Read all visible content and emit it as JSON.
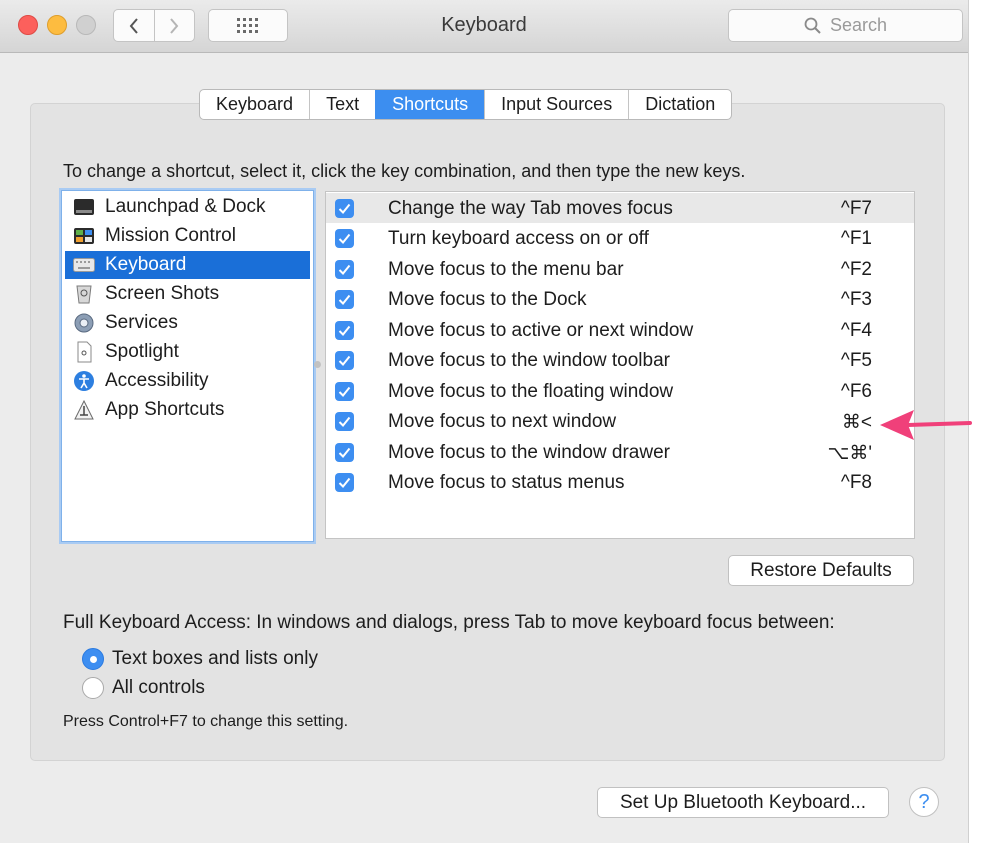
{
  "window": {
    "title": "Keyboard"
  },
  "search": {
    "placeholder": "Search"
  },
  "tabs": [
    {
      "label": "Keyboard",
      "active": false
    },
    {
      "label": "Text",
      "active": false
    },
    {
      "label": "Shortcuts",
      "active": true
    },
    {
      "label": "Input Sources",
      "active": false
    },
    {
      "label": "Dictation",
      "active": false
    }
  ],
  "instructions": "To change a shortcut, select it, click the key combination, and then type the new keys.",
  "categories": [
    {
      "label": "Launchpad & Dock",
      "icon": "launchpad-dock-icon",
      "selected": false
    },
    {
      "label": "Mission Control",
      "icon": "mission-control-icon",
      "selected": false
    },
    {
      "label": "Keyboard",
      "icon": "keyboard-icon",
      "selected": true
    },
    {
      "label": "Screen Shots",
      "icon": "screenshot-icon",
      "selected": false
    },
    {
      "label": "Services",
      "icon": "gear-icon",
      "selected": false
    },
    {
      "label": "Spotlight",
      "icon": "spotlight-icon",
      "selected": false
    },
    {
      "label": "Accessibility",
      "icon": "accessibility-icon",
      "selected": false
    },
    {
      "label": "App Shortcuts",
      "icon": "app-shortcuts-icon",
      "selected": false
    }
  ],
  "shortcuts": [
    {
      "label": "Change the way Tab moves focus",
      "key": "^F7",
      "checked": true,
      "selected": true
    },
    {
      "label": "Turn keyboard access on or off",
      "key": "^F1",
      "checked": true,
      "selected": false
    },
    {
      "label": "Move focus to the menu bar",
      "key": "^F2",
      "checked": true,
      "selected": false
    },
    {
      "label": "Move focus to the Dock",
      "key": "^F3",
      "checked": true,
      "selected": false
    },
    {
      "label": "Move focus to active or next window",
      "key": "^F4",
      "checked": true,
      "selected": false
    },
    {
      "label": "Move focus to the window toolbar",
      "key": "^F5",
      "checked": true,
      "selected": false
    },
    {
      "label": "Move focus to the floating window",
      "key": "^F6",
      "checked": true,
      "selected": false
    },
    {
      "label": "Move focus to next window",
      "key": "⌘<",
      "checked": true,
      "selected": false
    },
    {
      "label": "Move focus to the window drawer",
      "key": "⌥⌘'",
      "checked": true,
      "selected": false
    },
    {
      "label": "Move focus to status menus",
      "key": "^F8",
      "checked": true,
      "selected": false
    }
  ],
  "buttons": {
    "restore": "Restore Defaults",
    "bluetooth": "Set Up Bluetooth Keyboard...",
    "help": "?"
  },
  "full_keyboard_access": {
    "label": "Full Keyboard Access: In windows and dialogs, press Tab to move keyboard focus between:",
    "options": [
      {
        "label": "Text boxes and lists only",
        "selected": true
      },
      {
        "label": "All controls",
        "selected": false
      }
    ],
    "hint": "Press Control+F7 to change this setting."
  },
  "annotation": {
    "icon": "pink-arrow-icon",
    "color": "#f0407a",
    "points_to": "Move focus to next window"
  }
}
